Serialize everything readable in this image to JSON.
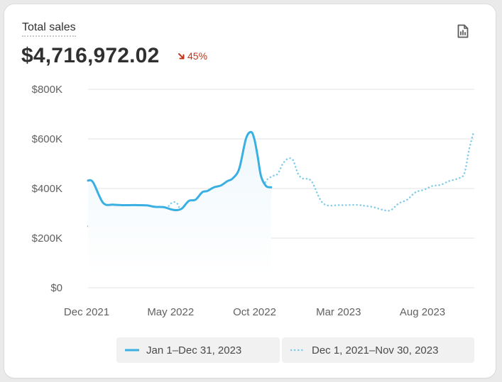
{
  "card": {
    "title": "Total sales",
    "value": "$4,716,972.02",
    "change": "45%",
    "change_direction": "down",
    "report_icon": "report-icon"
  },
  "colors": {
    "primary": "#3ab0e2",
    "comparison": "#7fcbea",
    "change_negative": "#c4341a",
    "grid": "#e3e3e3"
  },
  "chart_data": {
    "type": "line",
    "y_ticks": [
      "$0",
      "$200K",
      "$400K",
      "$600K",
      "$800K"
    ],
    "ylim": [
      0,
      800000
    ],
    "x_ticks": [
      "Dec 2021",
      "May 2022",
      "Oct 2022",
      "Mar 2023",
      "Aug 2023"
    ],
    "x_tick_index": [
      0,
      5,
      10,
      15,
      20
    ],
    "x_count": 24,
    "grid": true,
    "legend_position": "bottom-right",
    "series": [
      {
        "name": "Jan 1–Dec 31, 2023",
        "style": "solid",
        "area": true,
        "x": [
          0,
          0.3,
          0.9,
          1.5,
          2,
          2.5,
          3,
          3.5,
          4,
          4.5,
          5,
          5.3,
          5.6,
          6,
          6.4,
          6.8,
          7.1,
          7.5,
          7.9,
          8.3,
          8.6,
          9,
          9.4,
          9.7,
          9.9,
          10.1,
          10.3,
          10.6,
          10.9
        ],
        "values": [
          432000,
          425000,
          342000,
          335000,
          333000,
          333000,
          333000,
          332000,
          326000,
          325000,
          315000,
          313000,
          320000,
          350000,
          355000,
          385000,
          390000,
          405000,
          412000,
          430000,
          440000,
          480000,
          600000,
          628000,
          600000,
          530000,
          450000,
          410000,
          405000
        ]
      },
      {
        "name": "Dec 1, 2021–Nov 30, 2023",
        "style": "dotted",
        "area": false,
        "x": [
          0,
          0.5,
          1,
          1.3,
          1.6,
          1.9,
          2.3,
          2.8,
          3.3,
          3.8,
          4.2,
          4.6,
          5,
          5.3,
          5.6,
          6,
          6.5,
          7,
          7.5,
          8,
          8.5,
          9,
          9.4,
          9.8,
          10.2,
          10.6,
          11,
          11.3,
          11.6,
          11.9,
          12.2,
          12.5,
          12.8,
          13.3,
          14,
          15,
          16,
          16.5,
          17,
          17.5,
          18,
          18.5,
          19,
          19.5,
          20,
          20.5,
          21,
          21.5,
          22,
          22.4,
          22.7,
          22.95
        ],
        "values": [
          248000,
          265000,
          290000,
          285000,
          248000,
          232000,
          235000,
          285000,
          295000,
          310000,
          310000,
          315000,
          343000,
          340000,
          300000,
          290000,
          312000,
          318000,
          326000,
          330000,
          310000,
          300000,
          320000,
          350000,
          360000,
          430000,
          450000,
          460000,
          500000,
          520000,
          515000,
          460000,
          440000,
          430000,
          340000,
          333000,
          334000,
          330000,
          325000,
          315000,
          312000,
          340000,
          355000,
          385000,
          395000,
          410000,
          415000,
          430000,
          440000,
          460000,
          560000,
          625000
        ]
      }
    ]
  }
}
